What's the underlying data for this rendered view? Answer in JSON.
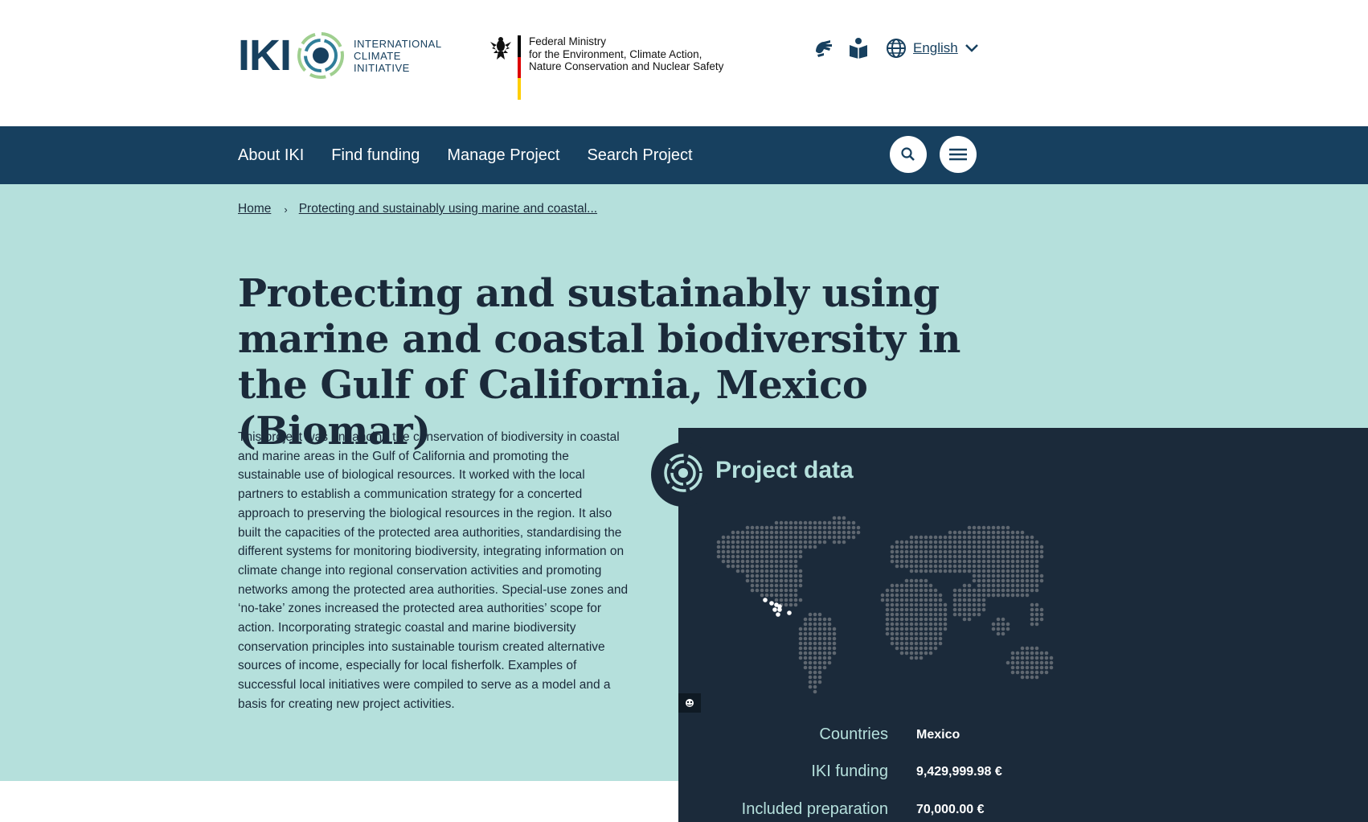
{
  "header": {
    "logo_letters": "IKI",
    "logo_text": [
      "INTERNATIONAL",
      "CLIMATE",
      "INITIATIVE"
    ],
    "ministry_lines": [
      "Federal Ministry",
      "for the Environment, Climate Action,",
      "Nature Conservation and Nuclear Safety"
    ],
    "flag_colors": [
      "#000000",
      "#dd0000",
      "#ffce00"
    ],
    "tools": [
      {
        "icon": "sign-language-icon"
      },
      {
        "icon": "easy-read-book-icon"
      }
    ],
    "language": {
      "icon": "globe-icon",
      "label": "English"
    }
  },
  "nav": {
    "items": [
      "About IKI",
      "Find funding",
      "Manage Project",
      "Search Project"
    ],
    "search_icon": "search-icon",
    "menu_icon": "hamburger-menu-icon"
  },
  "breadcrumb": {
    "home": "Home",
    "current": "Protecting and sustainably using marine and coastal..."
  },
  "page": {
    "title": "Protecting and sustainably using marine and coastal biodiversity in the Gulf of California, Mexico (Biomar)",
    "description": "This project was enhancing the conservation of biodiversity in coastal and marine areas in the Gulf of California and promoting the sustainable use of biological resources. It worked with the local partners to establish a communication strategy for a concerted approach to preserving the biological resources in the region. It also built the capacities of the protected area authorities, standardising the different systems for monitoring biodiversity, integrating information on climate change into regional conservation activities and promoting networks among the protected area authorities. Special-use zones and ‘no-take’ zones increased the protected area authorities’ scope for action. Incorporating strategic coastal and marine biodiversity conservation principles into sustainable tourism created alternative sources of income, especially for local fisherfolk. Examples of successful local initiatives were compiled to serve as a model and a basis for creating new project activities."
  },
  "project_data": {
    "title": "Project data",
    "rows": [
      {
        "label": "Countries",
        "value": "Mexico"
      },
      {
        "label": "IKI funding",
        "value": "9,429,999.98 €"
      },
      {
        "label": "Included preparation",
        "value": "70,000.00 €"
      }
    ]
  },
  "colors": {
    "navy": "#17405f",
    "hero_bg": "#b5e0dc",
    "panel_bg": "#1b2a3a",
    "map_dot": "#5f6770",
    "map_highlight": "#ffffff"
  }
}
